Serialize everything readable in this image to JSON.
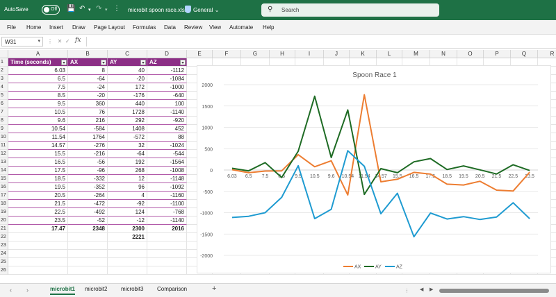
{
  "titlebar": {
    "autosave_label": "AutoSave",
    "autosave_state": "Off",
    "filename": "microbit spoon race.xlsx",
    "sensitivity": "General",
    "search_placeholder": "Search"
  },
  "menu": [
    "File",
    "Home",
    "Insert",
    "Draw",
    "Page Layout",
    "Formulas",
    "Data",
    "Review",
    "View",
    "Automate",
    "Help"
  ],
  "formula_bar": {
    "name_box": "W31",
    "fx": "fx",
    "value": ""
  },
  "columns": [
    "A",
    "B",
    "C",
    "D",
    "E",
    "F",
    "G",
    "H",
    "I",
    "J",
    "K",
    "L",
    "M",
    "N",
    "O",
    "P",
    "Q",
    "R"
  ],
  "rows": [
    "1",
    "2",
    "3",
    "4",
    "5",
    "6",
    "7",
    "8",
    "9",
    "10",
    "11",
    "12",
    "13",
    "14",
    "15",
    "16",
    "17",
    "18",
    "19",
    "20",
    "21",
    "22",
    "23",
    "24",
    "25",
    "26"
  ],
  "table": {
    "headers": [
      "Time (seconds)",
      "AX",
      "AY",
      "AZ"
    ],
    "data": [
      [
        "6.03",
        "8",
        "40",
        "-1112"
      ],
      [
        "6.5",
        "-64",
        "-20",
        "-1084"
      ],
      [
        "7.5",
        "-24",
        "172",
        "-1000"
      ],
      [
        "8.5",
        "-20",
        "-176",
        "-640"
      ],
      [
        "9.5",
        "360",
        "440",
        "100"
      ],
      [
        "10.5",
        "76",
        "1728",
        "-1140"
      ],
      [
        "9.6",
        "216",
        "292",
        "-920"
      ],
      [
        "10.54",
        "-584",
        "1408",
        "452"
      ],
      [
        "11.54",
        "1764",
        "-572",
        "88"
      ],
      [
        "14.57",
        "-276",
        "32",
        "-1024"
      ],
      [
        "15.5",
        "-216",
        "-64",
        "-544"
      ],
      [
        "16.5",
        "-56",
        "192",
        "-1564"
      ],
      [
        "17.5",
        "-96",
        "268",
        "-1008"
      ],
      [
        "18.5",
        "-332",
        "12",
        "-1148"
      ],
      [
        "19.5",
        "-352",
        "96",
        "-1092"
      ],
      [
        "20.5",
        "-264",
        "4",
        "-1160"
      ],
      [
        "21.5",
        "-472",
        "-92",
        "-1100"
      ],
      [
        "22.5",
        "-492",
        "124",
        "-768"
      ],
      [
        "23.5",
        "-52",
        "-12",
        "-1140"
      ]
    ],
    "totals": [
      "17.47",
      "2348",
      "2300",
      "2016"
    ],
    "grand_total": "2221"
  },
  "chart_data": {
    "type": "line",
    "title": "Spoon Race 1",
    "categories": [
      "6.03",
      "6.5",
      "7.5",
      "8.5",
      "9.5",
      "10.5",
      "9.6",
      "10.54",
      "11.54",
      "14.57",
      "15.5",
      "16.5",
      "17.5",
      "18.5",
      "19.5",
      "20.5",
      "21.5",
      "22.5",
      "23.5"
    ],
    "ylim": [
      -2000,
      2000
    ],
    "yticks": [
      "2000",
      "1500",
      "1000",
      "500",
      "0",
      "-500",
      "-1000",
      "-1500",
      "-2000"
    ],
    "grid": true,
    "legend_position": "bottom",
    "series": [
      {
        "name": "AX",
        "color": "#ed7d31",
        "values": [
          8,
          -64,
          -24,
          -20,
          360,
          76,
          216,
          -584,
          1764,
          -276,
          -216,
          -56,
          -96,
          -332,
          -352,
          -264,
          -472,
          -492,
          -52
        ]
      },
      {
        "name": "AY",
        "color": "#1e6b24",
        "values": [
          40,
          -20,
          172,
          -176,
          440,
          1728,
          292,
          1408,
          -572,
          32,
          -64,
          192,
          268,
          12,
          96,
          4,
          -92,
          124,
          -12
        ]
      },
      {
        "name": "AZ",
        "color": "#1f9bd1",
        "values": [
          -1112,
          -1084,
          -1000,
          -640,
          100,
          -1140,
          -920,
          452,
          88,
          -1024,
          -544,
          -1564,
          -1008,
          -1148,
          -1092,
          -1160,
          -1100,
          -768,
          -1140
        ]
      }
    ]
  },
  "sheets": [
    "microbit1",
    "microbit2",
    "microbit3",
    "Comparison"
  ],
  "active_sheet": "microbit1",
  "add_sheet": "+"
}
